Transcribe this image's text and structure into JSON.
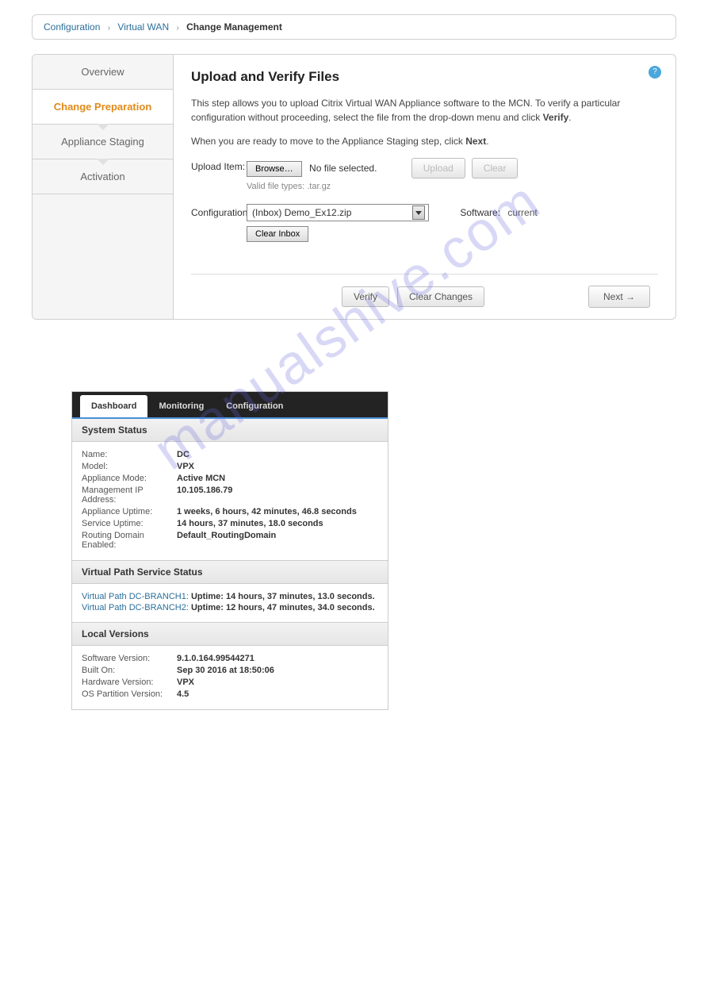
{
  "breadcrumb": {
    "items": [
      "Configuration",
      "Virtual WAN"
    ],
    "current": "Change Management"
  },
  "sidebar": {
    "steps": {
      "overview": "Overview",
      "change_prep": "Change Preparation",
      "appliance_staging": "Appliance Staging",
      "activation": "Activation"
    }
  },
  "main": {
    "title": "Upload and Verify Files",
    "desc_p1_a": "This step allows you to upload Citrix Virtual WAN Appliance software to the MCN. To verify a particular configuration without proceeding, select the file from the drop-down menu and click ",
    "desc_p1_bold": "Verify",
    "desc_p1_b": ".",
    "desc_p2_a": "When you are ready to move to the Appliance Staging step, click ",
    "desc_p2_bold": "Next",
    "desc_p2_b": ".",
    "upload_label": "Upload Item:",
    "browse_label": "Browse…",
    "no_file": "No file selected.",
    "valid_types": "Valid file types: .tar.gz",
    "upload_btn": "Upload",
    "clear_btn": "Clear",
    "config_label": "Configuration:",
    "config_selected": "(Inbox) Demo_Ex12.zip",
    "clear_inbox": "Clear Inbox",
    "software_label": "Software:",
    "software_value": "current",
    "verify_btn": "Verify",
    "clear_changes_btn": "Clear Changes",
    "next_btn": "Next →"
  },
  "dashboard": {
    "tabs": {
      "dashboard": "Dashboard",
      "monitoring": "Monitoring",
      "configuration": "Configuration"
    },
    "system_status": {
      "title": "System Status",
      "rows": {
        "name_k": "Name:",
        "name_v": "DC",
        "model_k": "Model:",
        "model_v": "VPX",
        "mode_k": "Appliance Mode:",
        "mode_v": "Active MCN",
        "mgmtip_k": "Management IP Address:",
        "mgmtip_v": "10.105.186.79",
        "appup_k": "Appliance Uptime:",
        "appup_v": "1 weeks, 6 hours, 42 minutes, 46.8 seconds",
        "svcup_k": "Service Uptime:",
        "svcup_v": "14 hours, 37 minutes, 18.0 seconds",
        "rd_k": "Routing Domain Enabled:",
        "rd_v": "Default_RoutingDomain"
      }
    },
    "vp_status": {
      "title": "Virtual Path Service Status",
      "rows": [
        {
          "link": "Virtual Path DC-BRANCH1:",
          "uptime": "Uptime: 14 hours, 37 minutes, 13.0 seconds."
        },
        {
          "link": "Virtual Path DC-BRANCH2:",
          "uptime": "Uptime: 12 hours, 47 minutes, 34.0 seconds."
        }
      ]
    },
    "local_versions": {
      "title": "Local Versions",
      "rows": {
        "sw_k": "Software Version:",
        "sw_v": "9.1.0.164.99544271",
        "built_k": "Built On:",
        "built_v": "Sep 30 2016 at 18:50:06",
        "hw_k": "Hardware Version:",
        "hw_v": "VPX",
        "os_k": "OS Partition Version:",
        "os_v": "4.5"
      }
    }
  },
  "watermark": "manualshive.com"
}
